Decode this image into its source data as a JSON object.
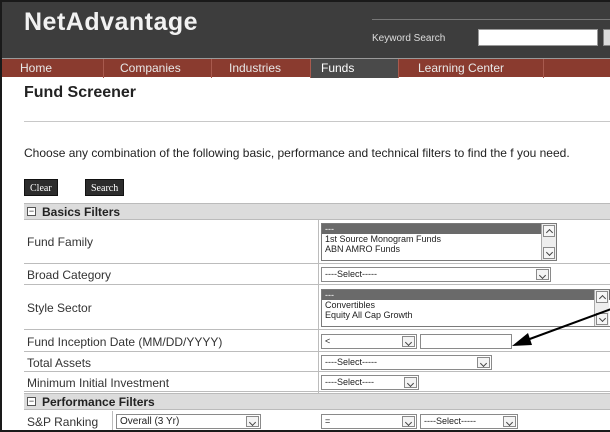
{
  "header": {
    "logo": "NetAdvantage",
    "keyword_label": "Keyword Search",
    "keyword_value": ""
  },
  "nav": {
    "items": [
      {
        "label": "Home"
      },
      {
        "label": "Companies"
      },
      {
        "label": "Industries"
      },
      {
        "label": "Funds",
        "active": true
      },
      {
        "label": "Learning Center"
      }
    ]
  },
  "page": {
    "title": "Fund Screener",
    "intro": "Choose any combination of the following basic, performance and technical filters to find the f you need.",
    "clear_label": "Clear",
    "search_label": "Search"
  },
  "basics": {
    "header": "Basics Filters",
    "fund_family": {
      "label": "Fund Family",
      "options": [
        "---",
        "1st Source Monogram Funds",
        "ABN AMRO Funds"
      ]
    },
    "broad_category": {
      "label": "Broad Category",
      "value": "----Select-----"
    },
    "style_sector": {
      "label": "Style Sector",
      "options": [
        "---",
        "Convertibles",
        "Equity All Cap Growth"
      ]
    },
    "inception_date": {
      "label": "Fund Inception Date (MM/DD/YYYY)",
      "operator": "<",
      "value": ""
    },
    "total_assets": {
      "label": "Total Assets",
      "value": "----Select-----"
    },
    "min_investment": {
      "label": "Minimum Initial Investment",
      "value": "----Select----"
    }
  },
  "performance": {
    "header": "Performance Filters",
    "sp_ranking": {
      "label": "S&P Ranking",
      "period": "Overall (3 Yr)",
      "operator": "=",
      "value": "----Select-----"
    }
  },
  "colors": {
    "header_bg": "#3d3d3d",
    "nav_bg": "#8a3b2f",
    "nav_active": "#4a4a4a",
    "section_bg": "#dcdcdc"
  }
}
